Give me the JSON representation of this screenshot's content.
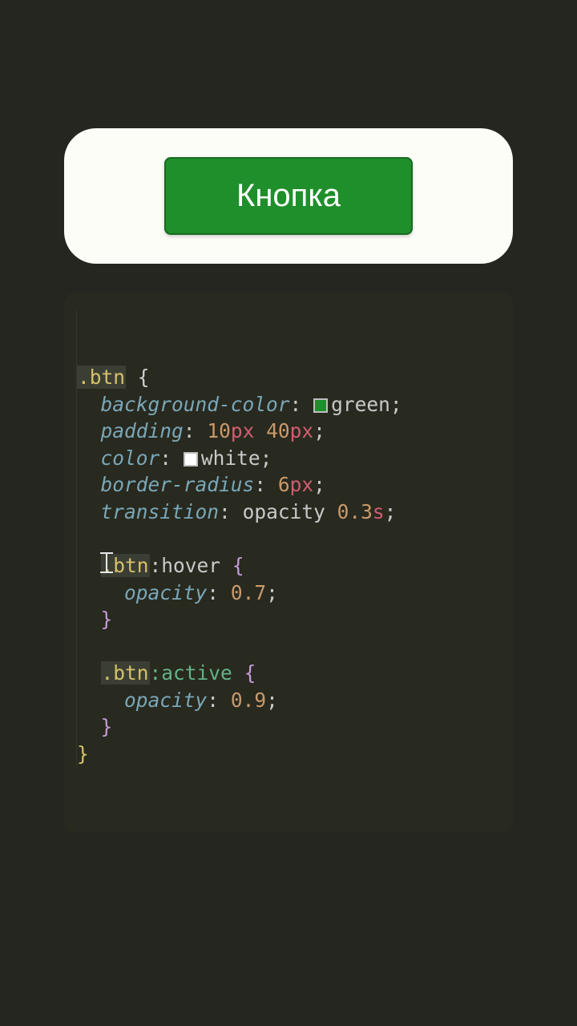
{
  "preview": {
    "button_label": "Кнопка"
  },
  "code": {
    "selector_btn": ".btn",
    "open_brace": " {",
    "close_brace": "}",
    "rules": {
      "bg": {
        "prop": "background-color",
        "value_name": "green"
      },
      "padding": {
        "prop": "padding",
        "v1_num": "10",
        "v1_unit": "px",
        "v2_num": "40",
        "v2_unit": "px"
      },
      "color": {
        "prop": "color",
        "value_name": "white"
      },
      "radius": {
        "prop": "border-radius",
        "num": "6",
        "unit": "px"
      },
      "transition": {
        "prop": "transition",
        "value_prop": "opacity",
        "dur_num": "0.3",
        "dur_unit": "s"
      }
    },
    "hover": {
      "selector_prefix": ".btn",
      "pseudo": ":hover",
      "prop": "opacity",
      "value": "0.7"
    },
    "active": {
      "selector": ".btn",
      "pseudo": ":active",
      "prop": "opacity",
      "value": "0.9"
    }
  }
}
